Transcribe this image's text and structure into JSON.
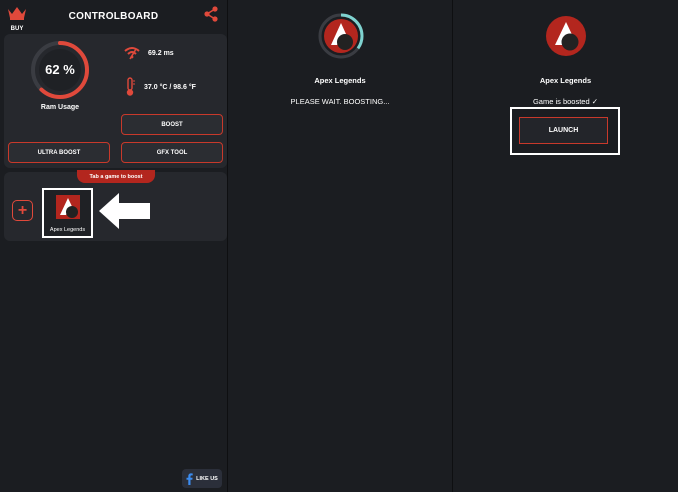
{
  "controlboard": {
    "buy_label": "BUY",
    "title": "CONTROLBOARD",
    "ram_value": "62 %",
    "ram_percent": 62,
    "ram_label": "Ram Usage",
    "ping": "69.2 ms",
    "temperature": "37.0 °C / 98.6 °F",
    "boost_label": "BOOST",
    "ultra_boost_label": "ULTRA BOOST",
    "gfx_tool_label": "GFX TOOL",
    "tap_hint": "Tab a game to boost",
    "game_name": "Apex Legends",
    "like_label": "LIKE US"
  },
  "boosting": {
    "game_title": "Apex Legends",
    "status": "PLEASE WAIT. BOOSTING...",
    "progress_percent": 35
  },
  "boosted": {
    "game_title": "Apex Legends",
    "status": "Game is boosted ✓",
    "launch_label": "LAUNCH"
  },
  "colors": {
    "background": "#1b1d21",
    "card": "#26282d",
    "accent_red": "#c8392b",
    "progress_teal": "#7fd3d0"
  },
  "icons": [
    "crown-icon",
    "share-icon",
    "wifi-icon",
    "thermometer-icon",
    "plus-icon",
    "arrow-left-icon",
    "facebook-icon",
    "apex-logo-icon"
  ]
}
